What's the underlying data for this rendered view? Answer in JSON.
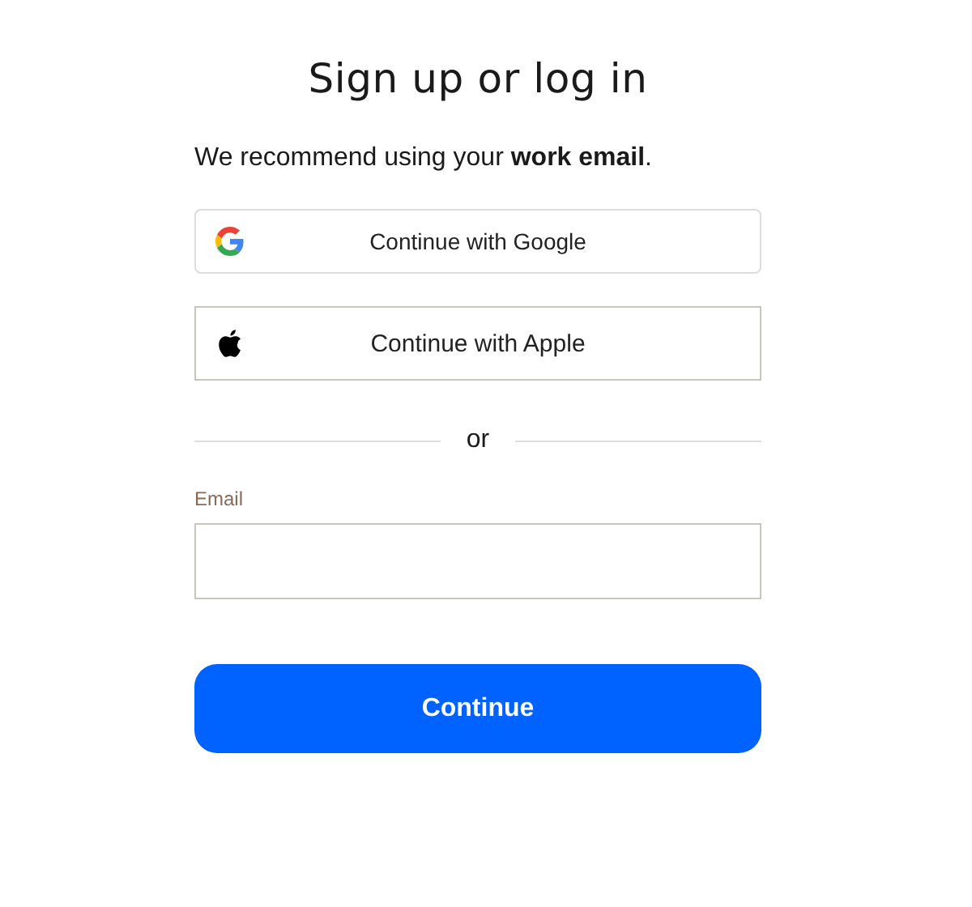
{
  "title": "Sign up or log in",
  "subtitle": "We recommend using your **work email**.",
  "providers": [
    {
      "kind": "google",
      "label": "Continue with Google"
    },
    {
      "kind": "apple",
      "label": "Continue with Apple"
    }
  ],
  "divider": "or",
  "email": {
    "label": "Email"
  },
  "submit": "Continue"
}
